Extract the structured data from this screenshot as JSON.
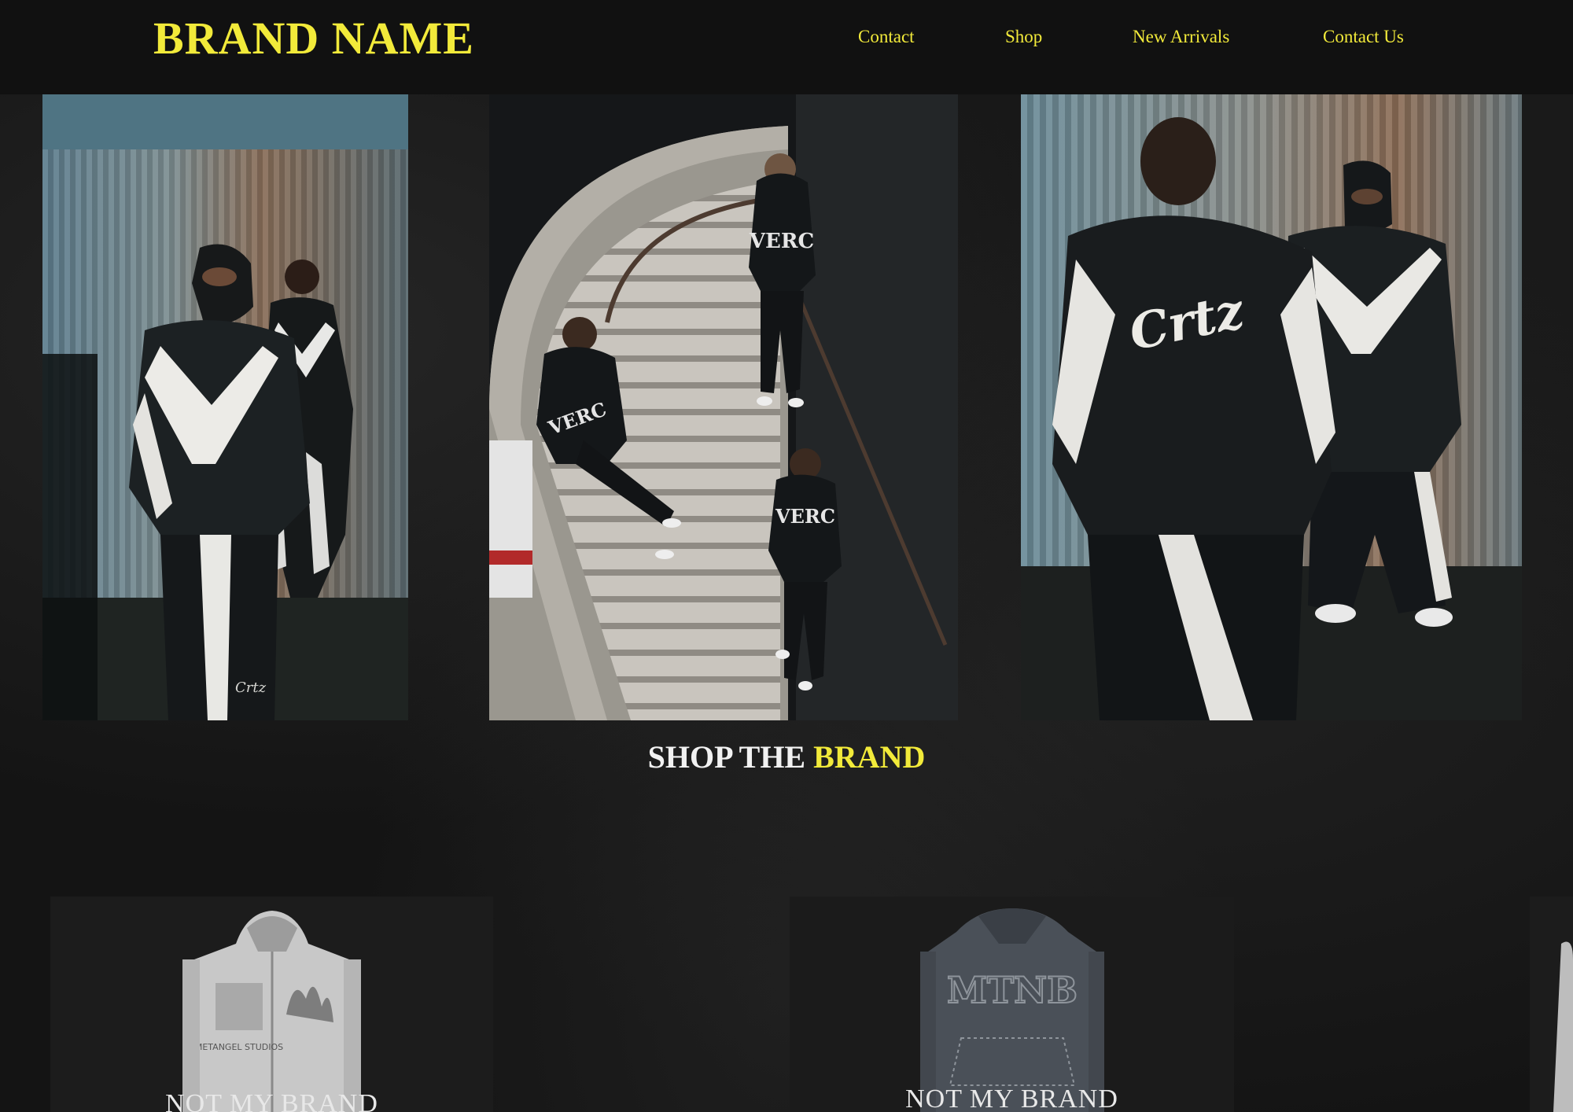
{
  "header": {
    "brand": "BRAND NAME",
    "nav": [
      "Contact",
      "Shop",
      "New Arrivals",
      "Contact Us"
    ]
  },
  "hero": {
    "photos": [
      {
        "name": "lookbook-photo-1",
        "jacket_print": "Crtz"
      },
      {
        "name": "lookbook-photo-2",
        "hoodie_print": "VERC"
      },
      {
        "name": "lookbook-photo-3",
        "jacket_print": "Crtz"
      }
    ]
  },
  "shop_section": {
    "title_part1": "SHOP THE",
    "title_part2": "BRAND"
  },
  "products": [
    {
      "name": "NOT MY BRAND",
      "print": "METANGEL STUDIOS"
    },
    {
      "name": "NOT MY BRAND",
      "print": "MTNB"
    }
  ],
  "colors": {
    "accent": "#f2ea3a",
    "background": "#141414",
    "title_white": "#f2f2f2"
  }
}
